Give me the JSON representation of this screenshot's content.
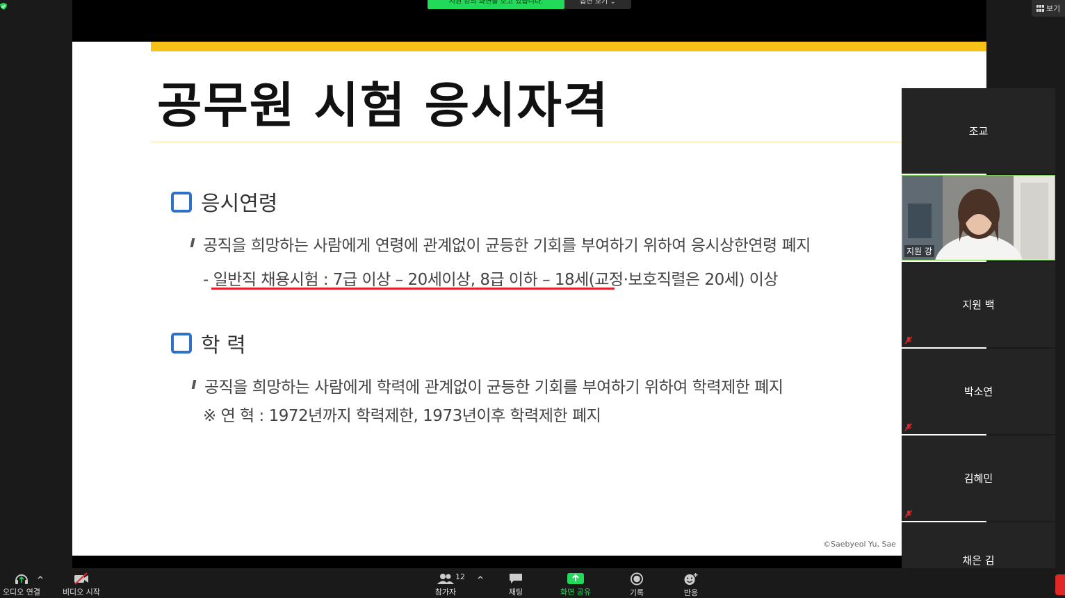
{
  "banner": {
    "viewing_text": "지원 강의 화면을 보고 있습니다.",
    "view_options": "옵션 보기 ⌄"
  },
  "top_right": {
    "view_label": "보기"
  },
  "slide": {
    "title": "공무원 시험 응시자격",
    "section1": {
      "heading": "응시연령",
      "line1": "공직을 희망하는 사람에게 연령에 관계없이 균등한 기회를 부여하기 위하여 응시상한연령 폐지",
      "line2": "-  일반직 채용시험 : 7급 이상 – 20세이상, 8급 이하 – 18세(교정·보호직렬은 20세) 이상"
    },
    "section2": {
      "heading": "학 력",
      "line1": "공직을 희망하는 사람에게 학력에 관계없이 균등한 기회를 부여하기 위하여 학력제한 폐지",
      "line2": "※ 연 혁 : 1972년까지 학력제한, 1973년이후 학력제한 폐지"
    },
    "copyright": "©Saebyeol Yu, Sae",
    "colors": {
      "accent_yellow": "#f6c21a",
      "box_blue": "#2e72c8",
      "underline_red": "#e0222a"
    }
  },
  "participants": [
    {
      "name": "조교",
      "muted": false
    },
    {
      "name": "지원 강",
      "video": true
    },
    {
      "name": "지원 백",
      "muted": true
    },
    {
      "name": "박소연",
      "muted": true
    },
    {
      "name": "김혜민",
      "muted": true
    },
    {
      "name": "채은 김",
      "muted": false
    }
  ],
  "toolbar": {
    "audio": "오디오 연결",
    "video": "비디오 시작",
    "participants": "참가자",
    "participant_count": "12",
    "chat": "채팅",
    "share": "화면 공유",
    "record": "기록",
    "reactions": "반응"
  }
}
